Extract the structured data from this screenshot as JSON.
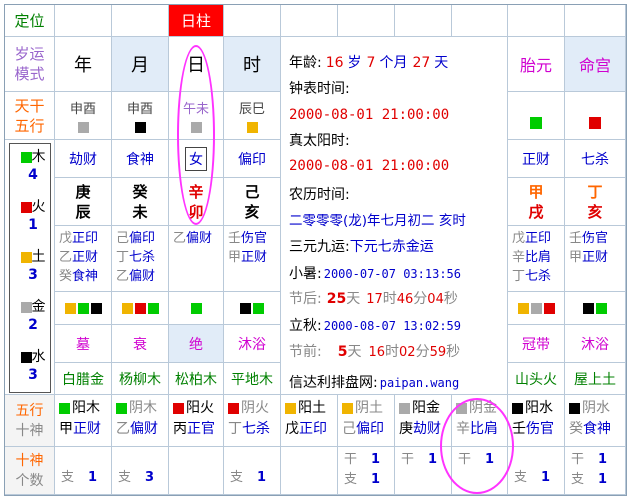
{
  "header": {
    "dingwei": "定位",
    "rizhu": "日柱",
    "suiyun": [
      "岁运",
      "模式"
    ],
    "columns": [
      "年",
      "月",
      "日",
      "时"
    ],
    "taiyuan": "胎元",
    "minggong": "命宫",
    "tiangan_wuxing": [
      "天干",
      "五行"
    ]
  },
  "kongwang": [
    "申酉",
    "申酉",
    "午未",
    "辰巳"
  ],
  "kongwang_colors": [
    "#aaaaaa",
    "#000000",
    "#aaaaaa",
    "#f0b400"
  ],
  "taiyuan_color": "#00cc00",
  "minggong_color": "#e00000",
  "shishen_top": [
    "劫财",
    "食神",
    "女",
    "偏印"
  ],
  "taiyuan_shishen": "正财",
  "minggong_shishen": "七杀",
  "ganzhi": [
    {
      "gan": "庚",
      "zhi": "辰"
    },
    {
      "gan": "癸",
      "zhi": "未"
    },
    {
      "gan": "辛",
      "zhi": "卯"
    },
    {
      "gan": "己",
      "zhi": "亥"
    }
  ],
  "taiyuan_ganzhi": {
    "gan": "甲",
    "zhi": "戌"
  },
  "minggong_ganzhi": {
    "gan": "丁",
    "zhi": "亥"
  },
  "wuxing_counts": [
    {
      "name": "木",
      "count": "4",
      "color": "#00cc00"
    },
    {
      "name": "火",
      "count": "1",
      "color": "#e00000"
    },
    {
      "name": "土",
      "count": "3",
      "color": "#f0b400"
    },
    {
      "name": "金",
      "count": "2",
      "color": "#aaaaaa"
    },
    {
      "name": "水",
      "count": "3",
      "color": "#000000"
    }
  ],
  "canggan": [
    [
      {
        "g": "戊",
        "s": "正印"
      },
      {
        "g": "乙",
        "s": "正财"
      },
      {
        "g": "癸",
        "s": "食神"
      }
    ],
    [
      {
        "g": "己",
        "s": "偏印"
      },
      {
        "g": "丁",
        "s": "七杀"
      },
      {
        "g": "乙",
        "s": "偏财"
      }
    ],
    [
      {
        "g": "乙",
        "s": "偏财"
      }
    ],
    [
      {
        "g": "壬",
        "s": "伤官"
      },
      {
        "g": "甲",
        "s": "正财"
      }
    ]
  ],
  "taiyuan_canggan": [
    {
      "g": "戊",
      "s": "正印"
    },
    {
      "g": "辛",
      "s": "比肩"
    },
    {
      "g": "丁",
      "s": "七杀"
    }
  ],
  "minggong_canggan": [
    {
      "g": "壬",
      "s": "伤官"
    },
    {
      "g": "甲",
      "s": "正财"
    }
  ],
  "canggan_colors": [
    [
      "#f0b400",
      "#00cc00",
      "#000000"
    ],
    [
      "#f0b400",
      "#e00000",
      "#00cc00"
    ],
    [
      "#00cc00"
    ],
    [
      "#000000",
      "#00cc00"
    ]
  ],
  "taiyuan_canggan_colors": [
    "#f0b400",
    "#aaaaaa",
    "#e00000"
  ],
  "minggong_canggan_colors": [
    "#000000",
    "#00cc00"
  ],
  "changsheng": [
    "墓",
    "衰",
    "绝",
    "沐浴"
  ],
  "taiyuan_changsheng": "冠带",
  "minggong_changsheng": "沐浴",
  "nayin": [
    "白腊金",
    "杨柳木",
    "松柏木",
    "平地木"
  ],
  "taiyuan_nayin": "山头火",
  "minggong_nayin": "屋上土",
  "info": {
    "age_label": "年龄:",
    "age_years": "16",
    "age_years_unit": "岁",
    "age_months": "7",
    "age_months_unit": "个月",
    "age_days": "27",
    "age_days_unit": "天",
    "clock_label": "钟表时间:",
    "clock_time": "2000-08-01 21:00:00",
    "solar_label": "真太阳时:",
    "solar_time": "2000-08-01 21:00:00",
    "lunar_label": "农历时间:",
    "lunar_text": "二零零零(龙)年七月初二 亥时",
    "sanyuan_label": "三元九运:",
    "sanyuan_value": "下元七赤金运",
    "xiaoshu_label": "小暑:",
    "xiaoshu_time": "2000-07-07 03:13:56",
    "after_label": "节后:",
    "after_d": "25",
    "after_d_u": "天",
    "after_h": "17",
    "after_h_u": "时",
    "after_m": "46",
    "after_m_u": "分",
    "after_s": "04",
    "after_s_u": "秒",
    "liqiu_label": "立秋:",
    "liqiu_time": "2000-08-07 13:02:59",
    "before_label": "节前:",
    "before_d": "5",
    "before_d_u": "天",
    "before_h": "16",
    "before_h_u": "时",
    "before_m": "02",
    "before_m_u": "分",
    "before_s": "59",
    "before_s_u": "秒",
    "site_label": "信达利排盘网:",
    "site_url": "paipan.wang"
  },
  "bottom_labels": {
    "wuxing_shishen": [
      "五行",
      "十神"
    ],
    "shishen_count": [
      "十神",
      "个数"
    ]
  },
  "bottom_cols": [
    {
      "top": "阳木",
      "color": "#00cc00",
      "dim": false,
      "g": "甲",
      "s": "正财",
      "k": "支",
      "v": "1",
      "v2": ""
    },
    {
      "top": "阴木",
      "color": "#00cc00",
      "dim": true,
      "g": "乙",
      "s": "偏财",
      "k": "支",
      "v": "3",
      "v2": ""
    },
    {
      "top": "阳火",
      "color": "#e00000",
      "dim": false,
      "g": "丙",
      "s": "正官",
      "k": "",
      "v": "",
      "v2": ""
    },
    {
      "top": "阴火",
      "color": "#e00000",
      "dim": true,
      "g": "丁",
      "s": "七杀",
      "k": "支",
      "v": "1",
      "v2": ""
    },
    {
      "top": "阳土",
      "color": "#f0b400",
      "dim": false,
      "g": "戊",
      "s": "正印",
      "k": "",
      "v": "",
      "v2": ""
    },
    {
      "top": "阴土",
      "color": "#f0b400",
      "dim": true,
      "g": "己",
      "s": "偏印",
      "k": "干",
      "v": "1",
      "k2": "支",
      "v2": "1"
    },
    {
      "top": "阳金",
      "color": "#aaaaaa",
      "dim": false,
      "g": "庚",
      "s": "劫财",
      "k": "干",
      "v": "1",
      "v2": ""
    },
    {
      "top": "阴金",
      "color": "#aaaaaa",
      "dim": true,
      "g": "辛",
      "s": "比肩",
      "k": "干",
      "v": "1",
      "v2": ""
    },
    {
      "top": "阳水",
      "color": "#000000",
      "dim": false,
      "g": "壬",
      "s": "伤官",
      "k": "支",
      "v": "1",
      "v2": ""
    },
    {
      "top": "阴水",
      "color": "#000000",
      "dim": true,
      "g": "癸",
      "s": "食神",
      "k": "干",
      "v": "1",
      "k2": "支",
      "v2": "1"
    }
  ]
}
